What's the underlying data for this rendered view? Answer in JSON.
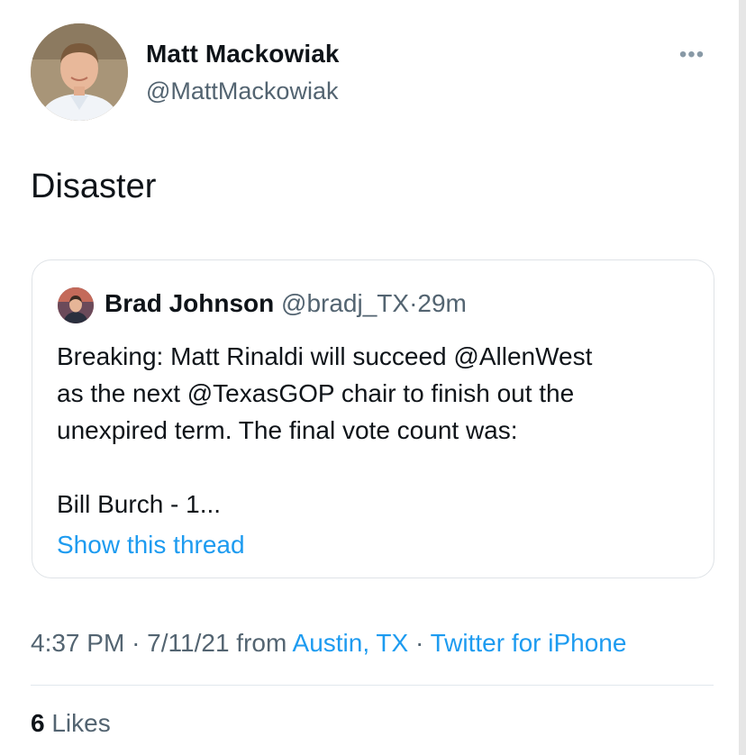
{
  "tweet": {
    "author": {
      "name": "Matt Mackowiak",
      "handle": "@MattMackowiak"
    },
    "more_icon": "more-dots-icon",
    "text": "Disaster",
    "quoted": {
      "name": "Brad Johnson",
      "handle": "@bradj_TX",
      "separator": "·",
      "time": "29m",
      "paragraph1": "Breaking: Matt Rinaldi will succeed @AllenWest\nas the next @TexasGOP chair to finish out the\nunexpired term. The final vote count was:",
      "paragraph2": "Bill Burch - 1...",
      "show_thread": "Show this thread"
    },
    "meta": {
      "time": "4:37 PM",
      "sep1": "·",
      "date": "7/11/21",
      "from": "from",
      "location": "Austin, TX",
      "sep2": "·",
      "client": "Twitter for iPhone"
    },
    "likes": {
      "count": "6",
      "label": "Likes"
    }
  }
}
